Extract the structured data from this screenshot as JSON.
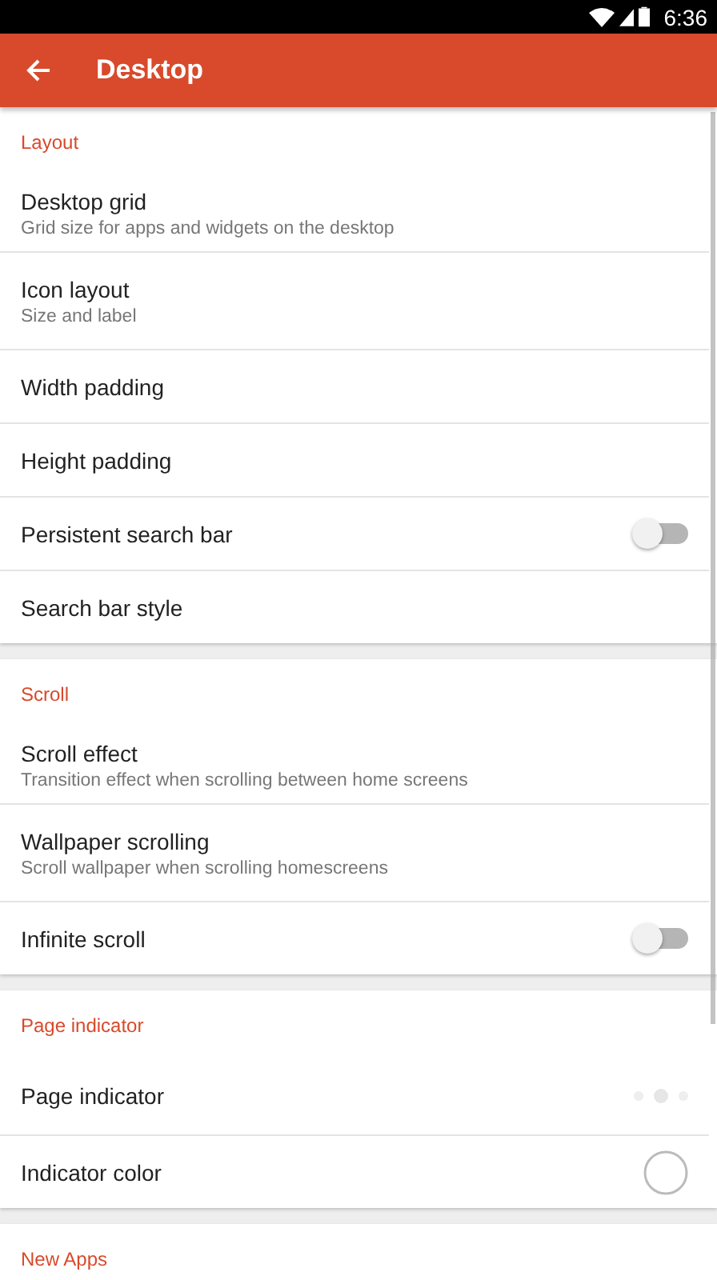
{
  "status_bar": {
    "time": "6:36"
  },
  "app_bar": {
    "title": "Desktop"
  },
  "sections": [
    {
      "title": "Layout",
      "rows": [
        {
          "kind": "plain",
          "title": "Desktop grid",
          "subtitle": "Grid size for apps and widgets on the desktop"
        },
        {
          "kind": "plain",
          "title": "Icon layout",
          "subtitle": "Size and label"
        },
        {
          "kind": "plain",
          "title": "Width padding"
        },
        {
          "kind": "plain",
          "title": "Height padding"
        },
        {
          "kind": "switch",
          "title": "Persistent search bar",
          "on": false
        },
        {
          "kind": "plain",
          "title": "Search bar style"
        }
      ]
    },
    {
      "title": "Scroll",
      "rows": [
        {
          "kind": "plain",
          "title": "Scroll effect",
          "subtitle": "Transition effect when scrolling between home screens"
        },
        {
          "kind": "plain",
          "title": "Wallpaper scrolling",
          "subtitle": "Scroll wallpaper when scrolling homescreens"
        },
        {
          "kind": "switch",
          "title": "Infinite scroll",
          "on": false
        }
      ]
    },
    {
      "title": "Page indicator",
      "rows": [
        {
          "kind": "dots",
          "title": "Page indicator"
        },
        {
          "kind": "color",
          "title": "Indicator color"
        }
      ]
    },
    {
      "title": "New Apps"
    }
  ]
}
